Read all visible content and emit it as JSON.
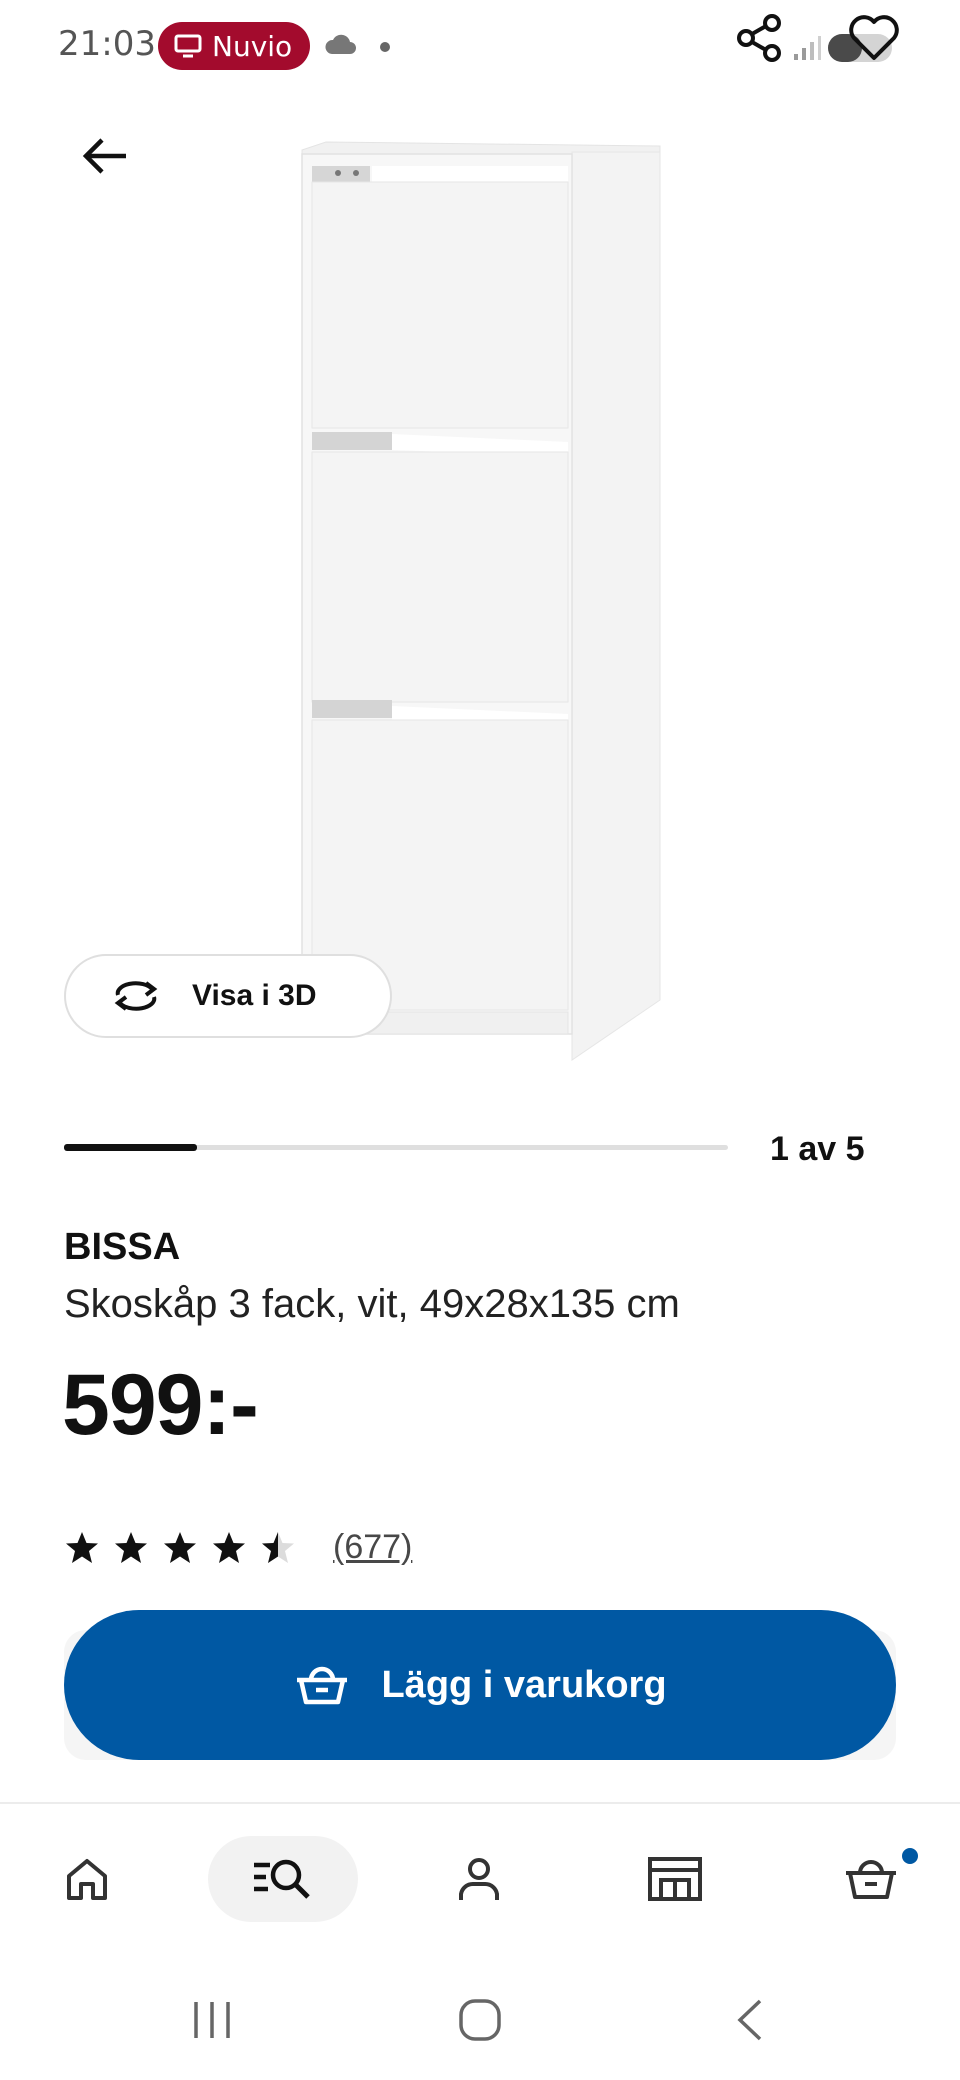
{
  "status_bar": {
    "time": "21:03",
    "app_pill": "Nuvio"
  },
  "gallery": {
    "view_3d_label": "Visa i 3D",
    "pager_text": "1 av 5",
    "current_index": 1,
    "total": 5
  },
  "product": {
    "name": "BISSA",
    "description": "Skoskåp 3 fack, vit, 49x28x135 cm",
    "price": "599:-",
    "rating": 4.5,
    "rating_max": 5,
    "review_count": "(677)"
  },
  "cta": {
    "label": "Lägg i varukorg"
  },
  "bottom_nav": {
    "items": [
      {
        "icon": "home-icon"
      },
      {
        "icon": "search-icon",
        "active": true
      },
      {
        "icon": "profile-icon"
      },
      {
        "icon": "store-icon"
      },
      {
        "icon": "cart-icon",
        "badge": true
      }
    ]
  },
  "colors": {
    "brand_blue": "#0058a3",
    "pill_red": "#a30b2d"
  }
}
